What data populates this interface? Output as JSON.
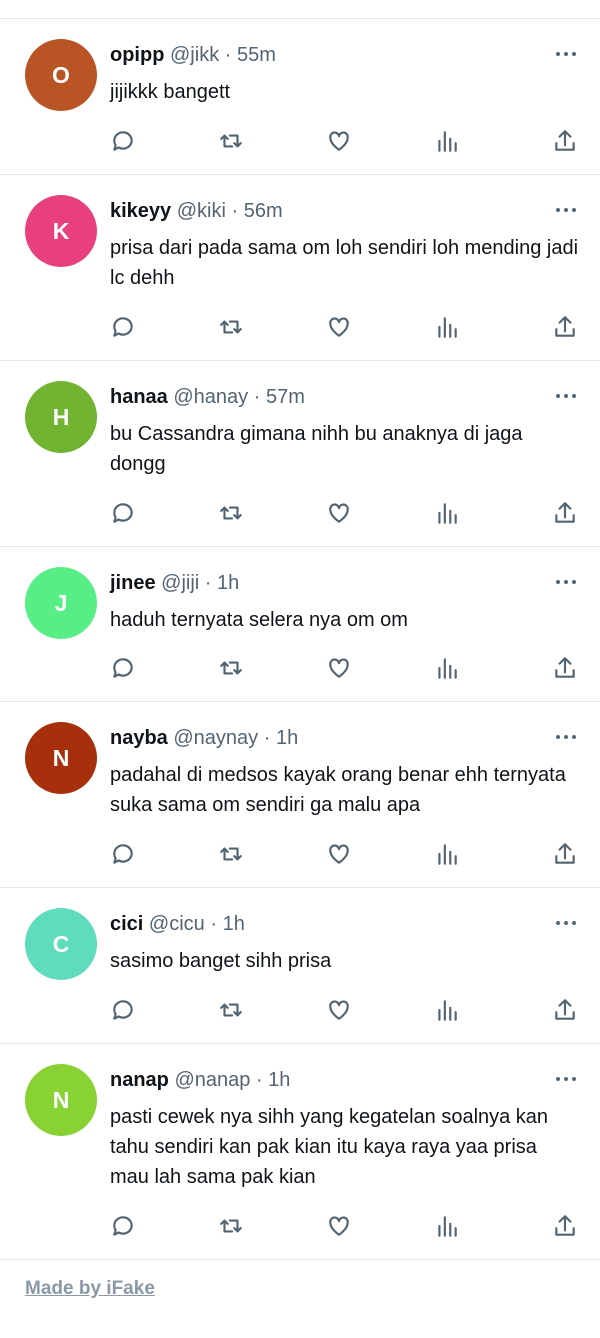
{
  "tweets": [
    {
      "initial": "O",
      "color": "#b95424",
      "name": "opipp",
      "handle": "@jikk",
      "time": "55m",
      "text": "jijikkk bangett"
    },
    {
      "initial": "K",
      "color": "#e8407d",
      "name": "kikeyy",
      "handle": "@kiki",
      "time": "56m",
      "text": "prisa dari pada sama om loh sendiri loh mending jadi lc dehh"
    },
    {
      "initial": "H",
      "color": "#70b431",
      "name": "hanaa",
      "handle": "@hanay",
      "time": "57m",
      "text": "bu Cassandra gimana nihh bu anaknya di jaga dongg"
    },
    {
      "initial": "J",
      "color": "#57ee86",
      "name": "jinee",
      "handle": "@jiji",
      "time": "1h",
      "text": "haduh ternyata selera nya om om"
    },
    {
      "initial": "N",
      "color": "#a5300b",
      "name": "nayba",
      "handle": "@naynay",
      "time": "1h",
      "text": "padahal di medsos kayak orang benar ehh ternyata suka sama om sendiri ga malu apa"
    },
    {
      "initial": "C",
      "color": "#5fdcbb",
      "name": "cici",
      "handle": "@cicu",
      "time": "1h",
      "text": "sasimo banget sihh prisa"
    },
    {
      "initial": "N",
      "color": "#89d234",
      "name": "nanap",
      "handle": "@nanap",
      "time": "1h",
      "text": "pasti cewek nya sihh yang kegatelan soalnya kan tahu sendiri kan pak kian itu kaya raya yaa prisa mau lah sama pak kian"
    }
  ],
  "icons": [
    "reply-icon",
    "retweet-icon",
    "like-icon",
    "views-icon",
    "share-icon"
  ],
  "footer": "Made by iFake"
}
